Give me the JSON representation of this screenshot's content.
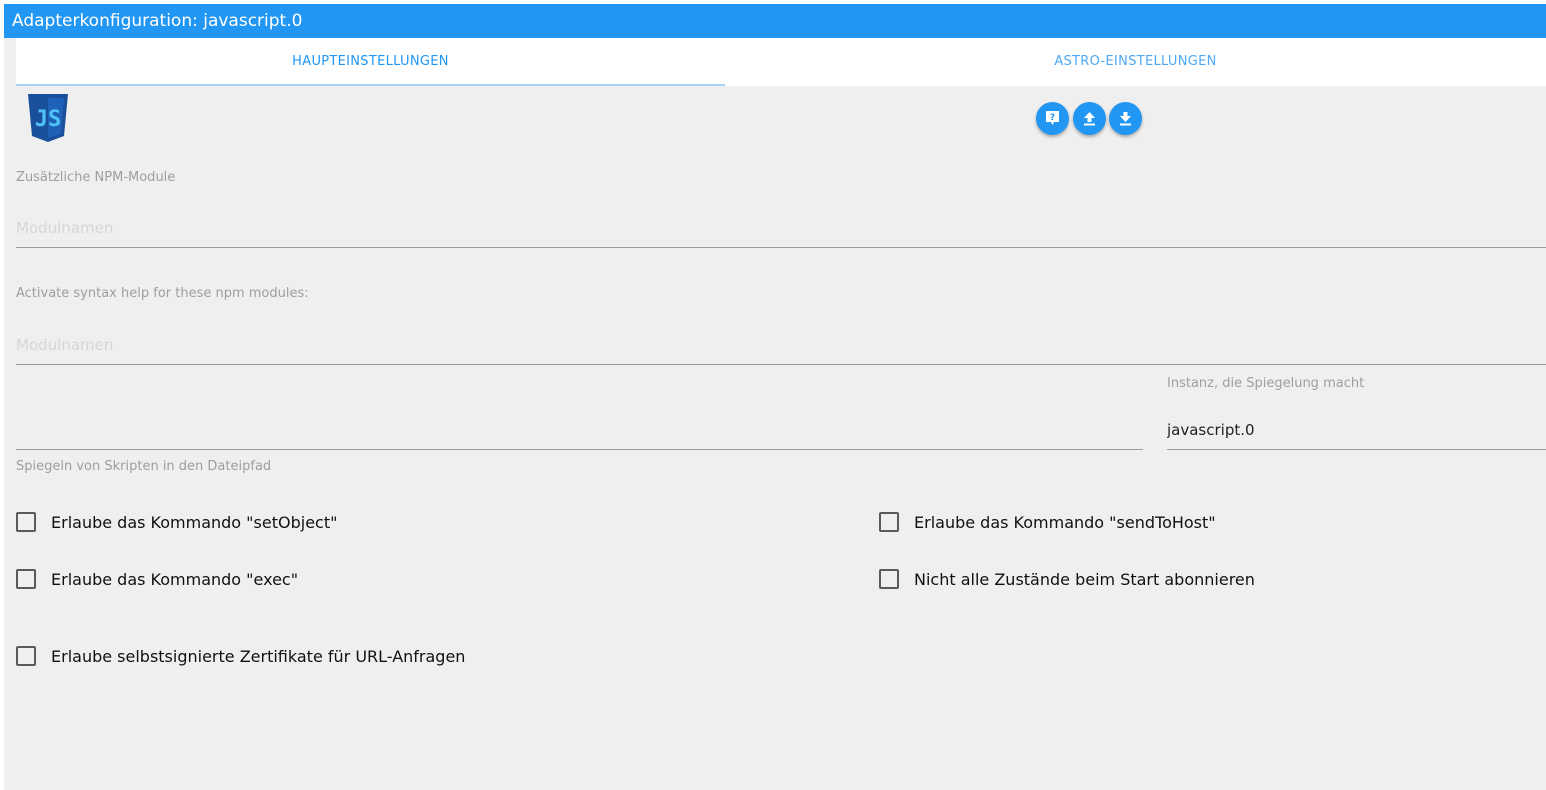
{
  "window": {
    "title": "Adapterkonfiguration: javascript.0"
  },
  "tabs": [
    {
      "label": "HAUPTEINSTELLUNGEN",
      "active": true
    },
    {
      "label": "ASTRO-EINSTELLUNGEN",
      "active": false
    }
  ],
  "logo": {
    "icon": "javascript-logo-icon",
    "text": "JS"
  },
  "toolbar": {
    "buttons": [
      {
        "icon": "help-icon"
      },
      {
        "icon": "upload-icon"
      },
      {
        "icon": "download-icon"
      }
    ]
  },
  "fields": {
    "npm_modules": {
      "label": "Zusätzliche NPM-Module",
      "placeholder": "Modulnamen",
      "value": ""
    },
    "syntax_help": {
      "label": "Activate syntax help for these npm modules:",
      "placeholder": "Modulnamen",
      "value": ""
    },
    "mirror_path": {
      "label": "Spiegeln von Skripten in den Dateipfad",
      "value": ""
    },
    "mirror_instance": {
      "label": "Instanz, die Spiegelung macht",
      "value": "javascript.0"
    }
  },
  "checkboxes": {
    "set_object": {
      "label": "Erlaube das Kommando \"setObject\"",
      "checked": false
    },
    "send_to_host": {
      "label": "Erlaube das Kommando \"sendToHost\"",
      "checked": false
    },
    "exec": {
      "label": "Erlaube das Kommando \"exec\"",
      "checked": false
    },
    "no_subscribe": {
      "label": "Nicht alle Zustände beim Start abonnieren",
      "checked": false
    },
    "self_signed": {
      "label": "Erlaube selbstsignierte Zertifikate für URL-Anfragen",
      "checked": false
    }
  },
  "colors": {
    "accent": "#2196f3",
    "background": "#efefef",
    "logo_shield": "#1a4f9c",
    "logo_text": "#4fc3f7"
  }
}
